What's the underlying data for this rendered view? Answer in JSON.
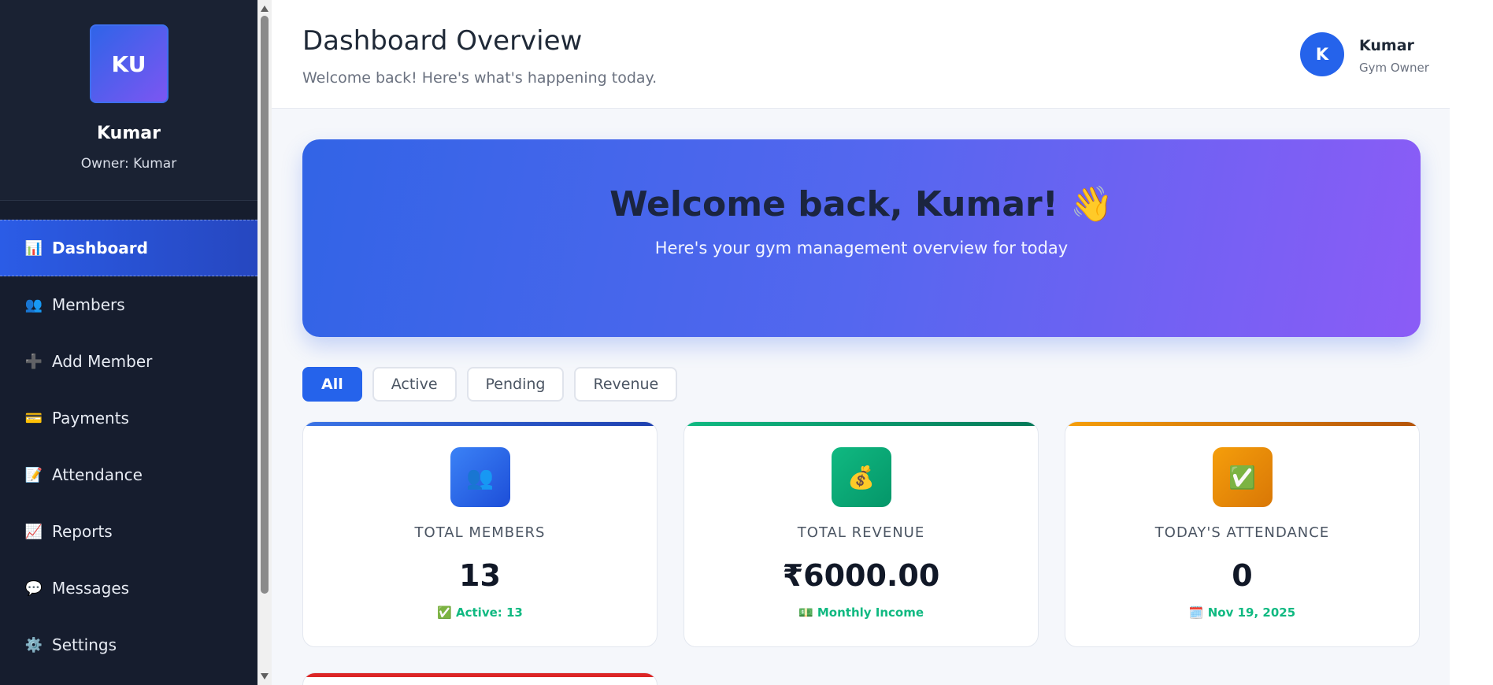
{
  "sidebar": {
    "avatar_initials": "KU",
    "name": "Kumar",
    "owner": "Owner: Kumar",
    "items": [
      {
        "label": "Dashboard",
        "icon": "📊",
        "active": true
      },
      {
        "label": "Members",
        "icon": "👥"
      },
      {
        "label": "Add Member",
        "icon": "➕"
      },
      {
        "label": "Payments",
        "icon": "💳"
      },
      {
        "label": "Attendance",
        "icon": "📝"
      },
      {
        "label": "Reports",
        "icon": "📈"
      },
      {
        "label": "Messages",
        "icon": "💬"
      },
      {
        "label": "Settings",
        "icon": "⚙️"
      }
    ]
  },
  "header": {
    "title": "Dashboard Overview",
    "subtitle": "Welcome back! Here's what's happening today.",
    "user_initial": "K",
    "user_name": "Kumar",
    "user_role": "Gym Owner"
  },
  "hero": {
    "title": "Welcome back, Kumar! 👋",
    "subtitle": "Here's your gym management overview for today"
  },
  "filters": [
    "All",
    "Active",
    "Pending",
    "Revenue"
  ],
  "cards": [
    {
      "label": "TOTAL MEMBERS",
      "value": "13",
      "note": "✅ Active: 13",
      "icon": "👥",
      "color": "#2563eb"
    },
    {
      "label": "TOTAL REVENUE",
      "value": "₹6000.00",
      "note": "💵 Monthly Income",
      "icon": "💰",
      "color": "#059669"
    },
    {
      "label": "TODAY'S ATTENDANCE",
      "value": "0",
      "note": "🗓️ Nov 19, 2025",
      "icon": "✅",
      "color": "#d97706"
    }
  ],
  "colors": {
    "sidebar_bg": "#161d2e",
    "accent": "#2563eb",
    "success": "#10b981"
  }
}
